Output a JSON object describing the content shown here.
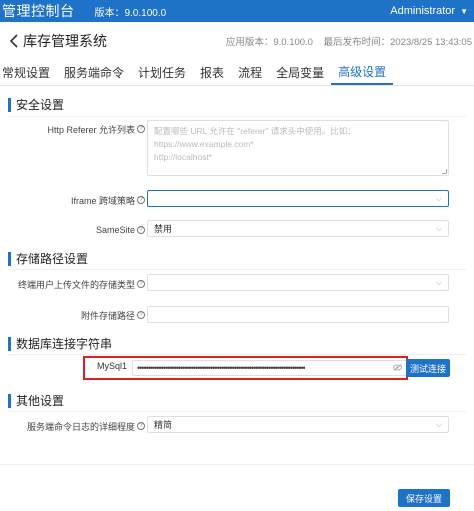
{
  "topbar": {
    "brand": "管理控制台",
    "version": "版本：9.0.100.0",
    "user": "Administrator"
  },
  "header": {
    "title": "库存管理系统",
    "app_version": "应用版本：9.0.100.0",
    "last_published": "最后发布时间：2023/8/25 13:43:05"
  },
  "tabs": [
    {
      "label": "常规设置"
    },
    {
      "label": "服务端命令"
    },
    {
      "label": "计划任务"
    },
    {
      "label": "报表"
    },
    {
      "label": "流程"
    },
    {
      "label": "全局变量"
    },
    {
      "label": "高级设置",
      "active": true
    }
  ],
  "security": {
    "title": "安全设置",
    "referer_label": "Http Referer 允许列表",
    "referer_placeholder": [
      "配置哪些 URL 允许在 \"referer\" 请求头中使用。比如：",
      "https://www.example.com*",
      "http://localhost*"
    ],
    "iframe_label": "Iframe 跨域策略",
    "iframe_value": "",
    "samesite_label": "SameSite",
    "samesite_value": "禁用"
  },
  "storage": {
    "title": "存储路径设置",
    "upload_type_label": "终端用户上传文件的存储类型",
    "upload_type_value": "",
    "attachment_path_label": "附件存储路径",
    "attachment_path_value": ""
  },
  "database": {
    "title": "数据库连接字符串",
    "conn_name": "MySql1",
    "conn_value_masked": "••••••••••••••••••••••••••••••••••••••••••••••••••••••••••••••••••••••••••••••",
    "test_button": "测试连接"
  },
  "other": {
    "title": "其他设置",
    "log_level_label": "服务端命令日志的详细程度",
    "log_level_value": "精简"
  },
  "save_button": "保存设置",
  "colors": {
    "primary": "#1e73c8",
    "highlight": "#e0201e"
  }
}
